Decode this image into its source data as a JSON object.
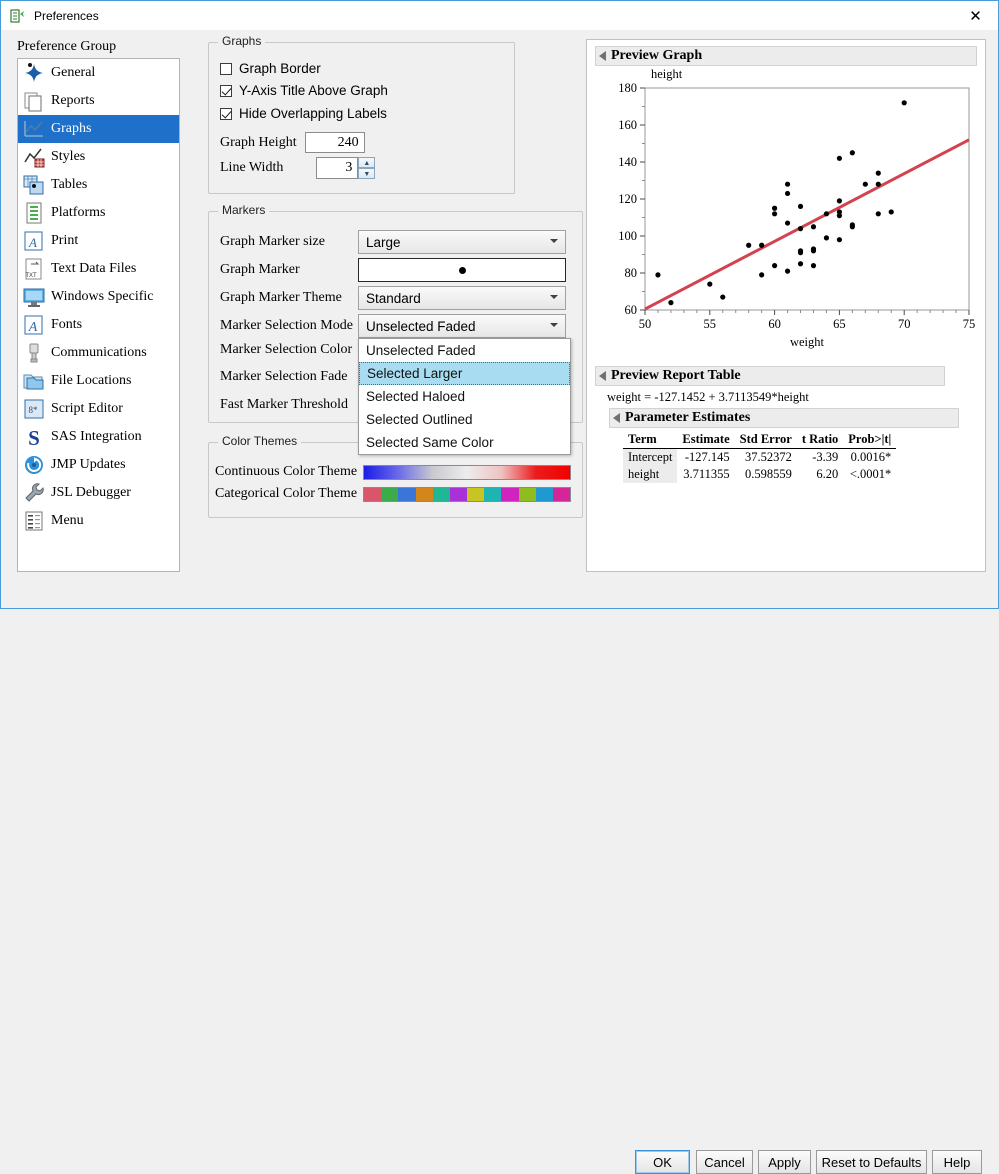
{
  "window": {
    "title": "Preferences",
    "icon": "jmp-preferences-icon",
    "close_label": "✕"
  },
  "sidebar": {
    "label": "Preference Group",
    "selected": "Graphs",
    "items": [
      {
        "label": "General",
        "icon": "star-burst-icon"
      },
      {
        "label": "Reports",
        "icon": "documents-icon"
      },
      {
        "label": "Graphs",
        "icon": "line-chart-icon"
      },
      {
        "label": "Styles",
        "icon": "chart-grid-icon"
      },
      {
        "label": "Tables",
        "icon": "table-icon"
      },
      {
        "label": "Platforms",
        "icon": "page-list-icon"
      },
      {
        "label": "Print",
        "icon": "print-page-icon"
      },
      {
        "label": "Text Data Files",
        "icon": "txt-file-icon"
      },
      {
        "label": "Windows Specific",
        "icon": "monitor-icon"
      },
      {
        "label": "Fonts",
        "icon": "font-a-icon"
      },
      {
        "label": "Communications",
        "icon": "usb-plug-icon"
      },
      {
        "label": "File Locations",
        "icon": "folder-icon"
      },
      {
        "label": "Script Editor",
        "icon": "script-editor-icon"
      },
      {
        "label": "SAS Integration",
        "icon": "sas-s-icon"
      },
      {
        "label": "JMP Updates",
        "icon": "refresh-circle-icon"
      },
      {
        "label": "JSL Debugger",
        "icon": "wrench-icon"
      },
      {
        "label": "Menu",
        "icon": "menu-list-icon"
      }
    ]
  },
  "graphs_group": {
    "title": "Graphs",
    "checkboxes": [
      {
        "label": "Graph Border",
        "checked": false
      },
      {
        "label": "Y-Axis Title Above Graph",
        "checked": true
      },
      {
        "label": "Hide Overlapping Labels",
        "checked": true
      }
    ],
    "graph_height": {
      "label": "Graph Height",
      "value": "240"
    },
    "line_width": {
      "label": "Line Width",
      "value": "3"
    }
  },
  "markers_group": {
    "title": "Markers",
    "rows": [
      {
        "label": "Graph Marker size",
        "value": "Large",
        "type": "combo"
      },
      {
        "label": "Graph Marker",
        "value": "●",
        "type": "marker"
      },
      {
        "label": "Graph Marker Theme",
        "value": "Standard",
        "type": "combo"
      },
      {
        "label": "Marker Selection Mode",
        "value": "Unselected Faded",
        "type": "combo"
      },
      {
        "label": "Marker Selection Color",
        "value": "",
        "type": "hidden"
      },
      {
        "label": "Marker Selection Fade",
        "value": "",
        "type": "hidden"
      },
      {
        "label": "Fast Marker Threshold",
        "value": "",
        "type": "hidden"
      }
    ],
    "dropdown": {
      "open": true,
      "highlighted": "Selected Larger",
      "options": [
        "Unselected Faded",
        "Selected Larger",
        "Selected Haloed",
        "Selected Outlined",
        "Selected Same Color"
      ]
    }
  },
  "color_themes": {
    "title": "Color Themes",
    "continuous": {
      "label": "Continuous Color Theme",
      "colors": [
        "#1c1ce6",
        "#6a6ae8",
        "#c9c9d0",
        "#ededed",
        "#efc2c2",
        "#ea1c1c",
        "#f20000"
      ]
    },
    "categorical": {
      "label": "Categorical Color Theme",
      "colors": [
        "#d9556a",
        "#3cab4a",
        "#3a76d8",
        "#d2861c",
        "#20b894",
        "#a832d8",
        "#c8c422",
        "#1fb4b4",
        "#d024c0",
        "#8fbc1e",
        "#1f9ad0",
        "#d4269a"
      ]
    }
  },
  "preview": {
    "graph_section": {
      "title": "Preview Graph"
    },
    "report_section": {
      "title": "Preview Report Table"
    },
    "equation": "weight = -127.1452 + 3.7113549*height",
    "param_section": {
      "title": "Parameter Estimates"
    },
    "table": {
      "headers": [
        "Term",
        "Estimate",
        "Std Error",
        "t Ratio",
        "Prob>|t|"
      ],
      "rows": [
        [
          "Intercept",
          "-127.145",
          "37.52372",
          "-3.39",
          "0.0016*"
        ],
        [
          "height",
          "3.711355",
          "0.598559",
          "6.20",
          "<.0001*"
        ]
      ]
    }
  },
  "chart_data": {
    "type": "scatter",
    "title": "Preview Graph",
    "xlabel": "weight",
    "ylabel": "height",
    "xlim": [
      50,
      75
    ],
    "ylim": [
      60,
      180
    ],
    "xticks": [
      50,
      55,
      60,
      65,
      70,
      75
    ],
    "yticks": [
      60,
      80,
      100,
      120,
      140,
      160,
      180
    ],
    "grid": false,
    "legend": "none",
    "marker_color": "#000000",
    "fit_line": {
      "color": "#d2424f",
      "equation": "weight = -127.1452 + 3.7113549*height",
      "x": [
        50,
        75
      ],
      "y": [
        60.5,
        152.0
      ]
    },
    "points": [
      {
        "x": 51,
        "y": 79
      },
      {
        "x": 52,
        "y": 64
      },
      {
        "x": 55,
        "y": 74
      },
      {
        "x": 56,
        "y": 67
      },
      {
        "x": 58,
        "y": 95
      },
      {
        "x": 59,
        "y": 95
      },
      {
        "x": 59,
        "y": 79
      },
      {
        "x": 60,
        "y": 115
      },
      {
        "x": 60,
        "y": 112
      },
      {
        "x": 60,
        "y": 84
      },
      {
        "x": 61,
        "y": 128
      },
      {
        "x": 61,
        "y": 123
      },
      {
        "x": 61,
        "y": 107
      },
      {
        "x": 61,
        "y": 81
      },
      {
        "x": 62,
        "y": 116
      },
      {
        "x": 62,
        "y": 104
      },
      {
        "x": 62,
        "y": 92
      },
      {
        "x": 62,
        "y": 91
      },
      {
        "x": 62,
        "y": 85
      },
      {
        "x": 63,
        "y": 105
      },
      {
        "x": 63,
        "y": 93
      },
      {
        "x": 63,
        "y": 92
      },
      {
        "x": 63,
        "y": 84
      },
      {
        "x": 64,
        "y": 112
      },
      {
        "x": 64,
        "y": 99
      },
      {
        "x": 65,
        "y": 142
      },
      {
        "x": 65,
        "y": 119
      },
      {
        "x": 65,
        "y": 113
      },
      {
        "x": 65,
        "y": 111
      },
      {
        "x": 65,
        "y": 98
      },
      {
        "x": 66,
        "y": 145
      },
      {
        "x": 66,
        "y": 106
      },
      {
        "x": 66,
        "y": 105
      },
      {
        "x": 67,
        "y": 128
      },
      {
        "x": 68,
        "y": 134
      },
      {
        "x": 68,
        "y": 128
      },
      {
        "x": 68,
        "y": 112
      },
      {
        "x": 69,
        "y": 113
      },
      {
        "x": 70,
        "y": 172
      }
    ]
  },
  "buttons": [
    {
      "label": "OK",
      "default": true
    },
    {
      "label": "Cancel",
      "default": false
    },
    {
      "label": "Apply",
      "default": false
    },
    {
      "label": "Reset to Defaults",
      "default": false
    },
    {
      "label": "Help",
      "default": false
    }
  ]
}
